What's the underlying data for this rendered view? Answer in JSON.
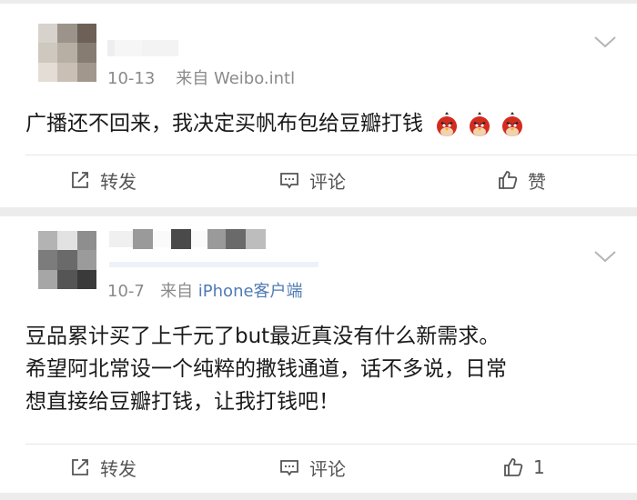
{
  "posts": [
    {
      "timestamp": "10-13",
      "source_prefix": "来自",
      "source_name": "Weibo.intl",
      "text": "广播还不回来，我决定买帆布包给豆瓣打钱",
      "emojis": [
        "angry-bird-emoji",
        "angry-bird-emoji",
        "angry-bird-emoji"
      ],
      "actions": {
        "repost_label": "转发",
        "comment_label": "评论",
        "like_label": "赞"
      }
    },
    {
      "timestamp": "10-7",
      "source_prefix": "来自",
      "source_name": "iPhone客户端",
      "text_lines": [
        "豆品累计买了上千元了but最近真没有什么新需求。",
        "希望阿北常设一个纯粹的撒钱通道，话不多说，日常",
        "想直接给豆瓣打钱，让我打钱吧！"
      ],
      "actions": {
        "repost_label": "转发",
        "comment_label": "评论",
        "like_label": "1"
      }
    }
  ],
  "icons": {
    "repost": "share-out-icon",
    "comment": "comment-bubble-icon",
    "like": "thumbs-up-icon",
    "menu": "chevron-down-icon"
  },
  "colors": {
    "background": "#ececec",
    "card": "#ffffff",
    "meta_text": "#8a8a8a",
    "link": "#4f7bb5",
    "body_text": "#1a1a1a"
  }
}
